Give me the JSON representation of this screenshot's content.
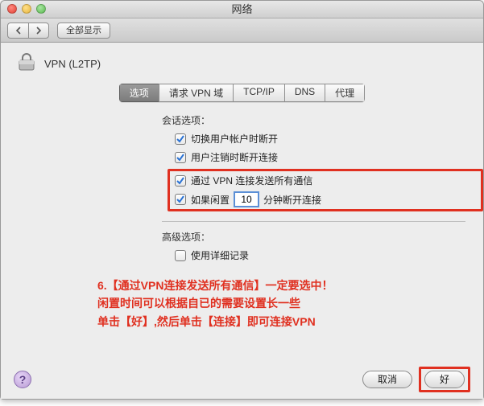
{
  "window": {
    "title": "网络"
  },
  "toolbar": {
    "show_all": "全部显示"
  },
  "header": {
    "vpn_label": "VPN (L2TP)"
  },
  "tabs": {
    "items": [
      "选项",
      "请求 VPN 域",
      "TCP/IP",
      "DNS",
      "代理"
    ],
    "active_index": 0
  },
  "session": {
    "heading": "会话选项：",
    "opt_switch_user": "切换用户帐户时断开",
    "opt_logout": "用户注销时断开连接",
    "opt_all_traffic": "通过 VPN 连接发送所有通信",
    "opt_idle_prefix": "如果闲置",
    "opt_idle_value": "10",
    "opt_idle_suffix": "分钟断开连接",
    "checked": {
      "switch_user": true,
      "logout": true,
      "all_traffic": true,
      "idle": true,
      "detailed_log": false
    }
  },
  "advanced": {
    "heading": "高级选项：",
    "opt_detailed_log": "使用详细记录"
  },
  "annotation": {
    "line1": "6.【通过VPN连接发送所有通信】一定要选中！",
    "line2": "闲置时间可以根据自已的需要设置长一些",
    "line3": "单击【好】,然后单击【连接】即可连接VPN"
  },
  "footer": {
    "cancel": "取消",
    "ok": "好"
  }
}
